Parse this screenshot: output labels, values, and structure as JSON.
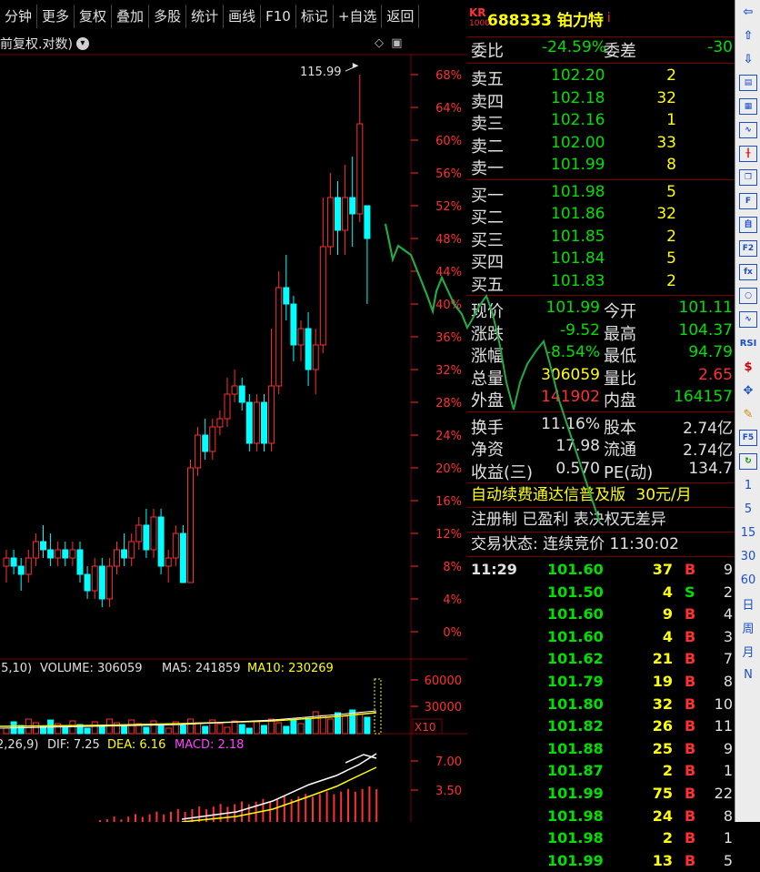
{
  "toolbar": {
    "items": [
      "分钟",
      "更多",
      "复权",
      "叠加",
      "多股",
      "统计",
      "画线",
      "F10",
      "标记",
      "+自选",
      "返回"
    ]
  },
  "chart_header": {
    "title": "前复权.对数)"
  },
  "price_axis": [
    "68%",
    "64%",
    "60%",
    "56%",
    "52%",
    "48%",
    "44%",
    "40%",
    "36%",
    "32%",
    "28%",
    "24%",
    "20%",
    "16%",
    "12%",
    "8%",
    "4%",
    "0%"
  ],
  "high_annotation": "115.99",
  "volume_header": {
    "prefix": "(5,10)",
    "volume": "VOLUME: 306059",
    "ma5": "MA5: 241859",
    "ma10": "MA10: 230269"
  },
  "volume_axis": [
    "60000",
    "30000",
    "X10"
  ],
  "macd_header": {
    "prefix": "2,26,9)",
    "dif": "DIF: 7.25",
    "dea": "DEA: 6.16",
    "macd": "MACD: 2.18"
  },
  "macd_axis": [
    "7.00",
    "3.50"
  ],
  "stock": {
    "market": "KR",
    "market_sub": "1000",
    "code_name": "688333 铂力特",
    "info": "i"
  },
  "weibi": {
    "label1": "委比",
    "value1": "-24.59%",
    "label2": "委差",
    "value2": "-30"
  },
  "asks": [
    {
      "label": "卖五",
      "price": "102.20",
      "vol": "2"
    },
    {
      "label": "卖四",
      "price": "102.18",
      "vol": "32"
    },
    {
      "label": "卖三",
      "price": "102.16",
      "vol": "1"
    },
    {
      "label": "卖二",
      "price": "102.00",
      "vol": "33"
    },
    {
      "label": "卖一",
      "price": "101.99",
      "vol": "8"
    }
  ],
  "bids": [
    {
      "label": "买一",
      "price": "101.98",
      "vol": "5"
    },
    {
      "label": "买二",
      "price": "101.86",
      "vol": "32"
    },
    {
      "label": "买三",
      "price": "101.85",
      "vol": "2"
    },
    {
      "label": "买四",
      "price": "101.84",
      "vol": "5"
    },
    {
      "label": "买五",
      "price": "101.83",
      "vol": "2"
    }
  ],
  "quote": [
    {
      "l1": "现价",
      "v1": "101.99",
      "c1": "c-green",
      "l2": "今开",
      "v2": "101.11",
      "c2": "c-green"
    },
    {
      "l1": "涨跌",
      "v1": "-9.52",
      "c1": "c-green",
      "l2": "最高",
      "v2": "104.37",
      "c2": "c-green"
    },
    {
      "l1": "涨幅",
      "v1": "-8.54%",
      "c1": "c-green",
      "l2": "最低",
      "v2": "94.79",
      "c2": "c-green"
    },
    {
      "l1": "总量",
      "v1": "306059",
      "c1": "c-yellow",
      "l2": "量比",
      "v2": "2.65",
      "c2": "c-red"
    },
    {
      "l1": "外盘",
      "v1": "141902",
      "c1": "c-red",
      "l2": "内盘",
      "v2": "164157",
      "c2": "c-green"
    }
  ],
  "fundamentals": [
    {
      "l1": "换手",
      "v1": "11.16%",
      "l2": "股本",
      "v2": "2.74亿"
    },
    {
      "l1": "净资",
      "v1": "17.98",
      "l2": "流通",
      "v2": "2.74亿"
    },
    {
      "l1": "收益(三)",
      "v1": "0.570",
      "l2": "PE(动)",
      "v2": "134.7"
    }
  ],
  "ad_line": {
    "text": "自动续费通达信普及版",
    "price": "30元/月"
  },
  "flags": "注册制 已盈利 表决权无差异",
  "trade_status": "交易状态: 连续竞价 11:30:02",
  "ticks": [
    {
      "time": "11:29",
      "price": "101.60",
      "vol": "37",
      "dir": "B",
      "cnt": "9"
    },
    {
      "time": "",
      "price": "101.50",
      "vol": "4",
      "dir": "S",
      "cnt": "2"
    },
    {
      "time": "",
      "price": "101.60",
      "vol": "9",
      "dir": "B",
      "cnt": "4"
    },
    {
      "time": "",
      "price": "101.60",
      "vol": "4",
      "dir": "B",
      "cnt": "3"
    },
    {
      "time": "",
      "price": "101.62",
      "vol": "21",
      "dir": "B",
      "cnt": "7"
    },
    {
      "time": "",
      "price": "101.79",
      "vol": "19",
      "dir": "B",
      "cnt": "8"
    },
    {
      "time": "",
      "price": "101.80",
      "vol": "32",
      "dir": "B",
      "cnt": "10"
    },
    {
      "time": "",
      "price": "101.82",
      "vol": "26",
      "dir": "B",
      "cnt": "11"
    },
    {
      "time": "",
      "price": "101.88",
      "vol": "25",
      "dir": "B",
      "cnt": "9"
    },
    {
      "time": "",
      "price": "101.87",
      "vol": "2",
      "dir": "B",
      "cnt": "1"
    },
    {
      "time": "",
      "price": "101.99",
      "vol": "75",
      "dir": "B",
      "cnt": "22"
    },
    {
      "time": "",
      "price": "101.98",
      "vol": "24",
      "dir": "B",
      "cnt": "8"
    },
    {
      "time": "",
      "price": "101.98",
      "vol": "2",
      "dir": "B",
      "cnt": "1"
    },
    {
      "time": "",
      "price": "101.99",
      "vol": "13",
      "dir": "B",
      "cnt": "5"
    }
  ],
  "sidebar_items": [
    "1",
    "5",
    "15",
    "30",
    "60",
    "日",
    "周",
    "月",
    "N"
  ],
  "colors": {
    "up": "#ff3030",
    "down": "#00ffff",
    "grid": "#7a0000",
    "ma_yellow": "#ffff00",
    "ma_white": "#ffffff",
    "annotation": "#22aa44"
  }
}
